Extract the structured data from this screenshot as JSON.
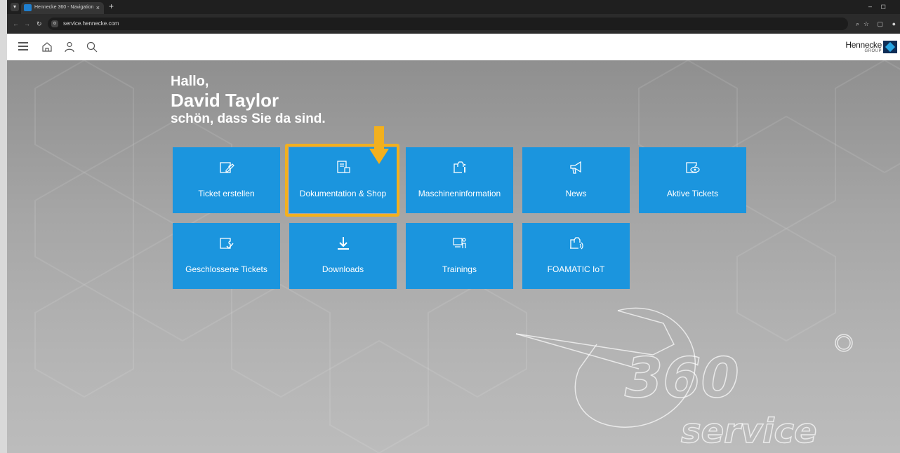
{
  "browser": {
    "tab_title": "Hennecke 360 - Navigation",
    "tab_close": "×",
    "new_tab": "+",
    "minimize": "–",
    "restore": "◻",
    "url": "service.hennecke.com"
  },
  "header": {
    "logo_name": "Hennecke",
    "logo_sub": "GROUP"
  },
  "greeting": {
    "hello": "Hallo,",
    "name": "David Taylor",
    "subtitle": "schön, dass Sie da sind."
  },
  "tiles": [
    {
      "label": "Ticket erstellen",
      "icon": "ticket-edit-icon"
    },
    {
      "label": "Dokumentation & Shop",
      "icon": "documentation-shop-icon"
    },
    {
      "label": "Maschineninformation",
      "icon": "machine-info-icon"
    },
    {
      "label": "News",
      "icon": "megaphone-icon"
    },
    {
      "label": "Aktive Tickets",
      "icon": "ticket-eye-icon"
    },
    {
      "label": "Geschlossene Tickets",
      "icon": "ticket-check-icon"
    },
    {
      "label": "Downloads",
      "icon": "download-icon"
    },
    {
      "label": "Trainings",
      "icon": "training-icon"
    },
    {
      "label": "FOAMATIC IoT",
      "icon": "iot-machine-icon"
    }
  ],
  "highlighted_tile": "Dokumentation & Shop",
  "colors": {
    "tile": "#1b95de",
    "highlight": "#f2b01e",
    "header_bg": "#ffffff"
  }
}
